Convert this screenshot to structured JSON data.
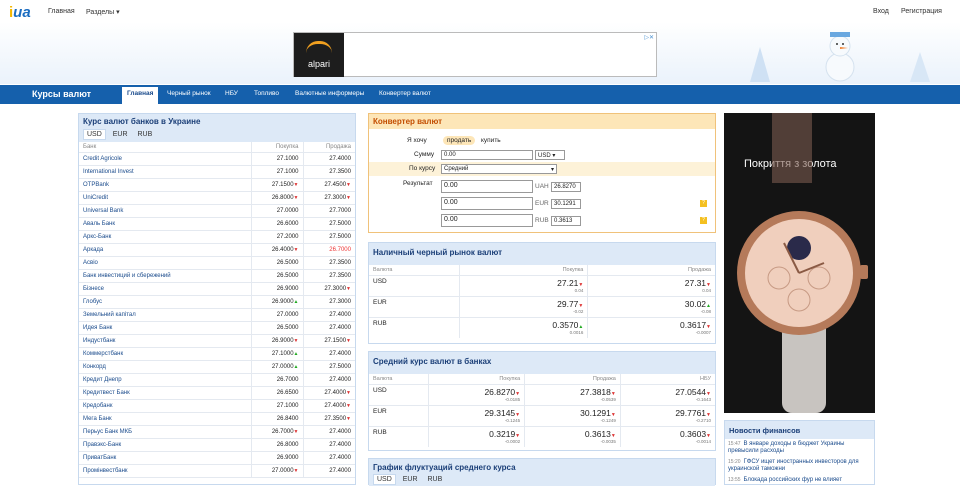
{
  "top": {
    "logo_main": "i",
    "logo_ua": "ua",
    "home": "Главная",
    "sections": "Разделы",
    "login": "Вход",
    "register": "Регистрация"
  },
  "ad": {
    "brand": "alpari"
  },
  "nav": {
    "title": "Курсы валют",
    "items": [
      "Главная",
      "Черный рынок",
      "НБУ",
      "Топливо",
      "Валютные информеры",
      "Конвертер валют"
    ]
  },
  "banks": {
    "title": "Курс валют банков в Украине",
    "tabs": [
      "USD",
      "EUR",
      "RUB"
    ],
    "col_bank": "Банк",
    "col_buy": "Покупка",
    "col_sell": "Продажа",
    "rows": [
      [
        "Credit Agricole",
        "27.1000",
        "",
        "27.4000",
        ""
      ],
      [
        "International Invest",
        "27.1000",
        "",
        "27.3500",
        ""
      ],
      [
        "OTPBank",
        "27.1500",
        "dn",
        "27.4500",
        "dn"
      ],
      [
        "UniCredit",
        "26.8000",
        "dn",
        "27.3000",
        "dn"
      ],
      [
        "Universal Bank",
        "27.0000",
        "",
        "27.7000",
        ""
      ],
      [
        "Аваль Банк",
        "26.6000",
        "",
        "27.5000",
        ""
      ],
      [
        "Аркс-Банк",
        "27.2000",
        "",
        "27.5000",
        ""
      ],
      [
        "Аркада",
        "26.4000",
        "dn",
        "26.7000",
        "red"
      ],
      [
        "Асвіо",
        "26.5000",
        "",
        "27.3500",
        ""
      ],
      [
        "Банк инвестиций и сбережений",
        "26.5000",
        "",
        "27.3500",
        ""
      ],
      [
        "Бізнесе",
        "26.9000",
        "",
        "27.3000",
        "dn"
      ],
      [
        "Глобус",
        "26.9000",
        "up",
        "27.3000",
        ""
      ],
      [
        "Земельний капітал",
        "27.0000",
        "",
        "27.4000",
        ""
      ],
      [
        "Идея Банк",
        "26.5000",
        "",
        "27.4000",
        ""
      ],
      [
        "Индустбанк",
        "26.9000",
        "dn",
        "27.1500",
        "dn"
      ],
      [
        "Коммерстбанк",
        "27.1000",
        "up",
        "27.4000",
        ""
      ],
      [
        "Конкорд",
        "27.0000",
        "up",
        "27.5000",
        ""
      ],
      [
        "Кредит Днепр",
        "26.7000",
        "",
        "27.4000",
        ""
      ],
      [
        "Кредитвест Банк",
        "26.6500",
        "",
        "27.4000",
        "dn"
      ],
      [
        "Кредобанк",
        "27.1000",
        "",
        "27.4000",
        "dn"
      ],
      [
        "Мега Банк",
        "26.8400",
        "",
        "27.3500",
        "dn"
      ],
      [
        "Перьуc Банк МКБ",
        "26.7000",
        "dn",
        "27.4000",
        ""
      ],
      [
        "Правэкс-Банк",
        "26.8000",
        "",
        "27.4000",
        ""
      ],
      [
        "ПриватБанк",
        "26.9000",
        "",
        "27.4000",
        ""
      ],
      [
        "Промінвестбанк",
        "27.0000",
        "dn",
        "27.4000",
        ""
      ]
    ]
  },
  "converter": {
    "title": "Конвертер валют",
    "want_label": "Я хочу",
    "sell": "продать",
    "buy": "купить",
    "sum_label": "Сумму",
    "sum_value": "0.00",
    "currency": "USD",
    "rate_label": "По курсу",
    "rate_value": "Средний",
    "result_label": "Результат",
    "results": [
      {
        "value": "0.00",
        "cur": "UAH",
        "rate": "26.8270"
      },
      {
        "value": "0.00",
        "cur": "EUR",
        "rate": "30.1291"
      },
      {
        "value": "0.00",
        "cur": "RUB",
        "rate": "0.3613"
      }
    ]
  },
  "black": {
    "title": "Наличный черный рынок валют",
    "col_cur": "Валюта",
    "col_buy": "Покупка",
    "col_sell": "Продажа",
    "rows": [
      {
        "cur": "USD",
        "buy": "27.21",
        "buy_d": "0.04",
        "buy_dir": "dn",
        "sell": "27.31",
        "sell_d": "0.04",
        "sell_dir": "dn"
      },
      {
        "cur": "EUR",
        "buy": "29.77",
        "buy_d": "-0.02",
        "buy_dir": "dn",
        "sell": "30.02",
        "sell_d": "-0.08",
        "sell_dir": "up"
      },
      {
        "cur": "RUB",
        "buy": "0.3570",
        "buy_d": "0.0016",
        "buy_dir": "up",
        "sell": "0.3617",
        "sell_d": "-0.0007",
        "sell_dir": "dn"
      }
    ]
  },
  "avg": {
    "title": "Средний курс валют в банках",
    "col_cur": "Валюта",
    "col_buy": "Покупка",
    "col_sell": "Продажа",
    "col_nbu": "НБУ",
    "rows": [
      {
        "cur": "USD",
        "buy": "26.8270",
        "buy_d": "-0.0185",
        "sell": "27.3818",
        "sell_d": "-0.0539",
        "nbu": "27.0544",
        "nbu_d": "-0.1643"
      },
      {
        "cur": "EUR",
        "buy": "29.3145",
        "buy_d": "-0.1245",
        "sell": "30.1291",
        "sell_d": "-0.1249",
        "nbu": "29.7761",
        "nbu_d": "-0.2710"
      },
      {
        "cur": "RUB",
        "buy": "0.3219",
        "buy_d": "-0.0002",
        "sell": "0.3613",
        "sell_d": "-0.0035",
        "nbu": "0.3603",
        "nbu_d": "-0.0014"
      }
    ]
  },
  "chart": {
    "title": "График флуктуаций среднего курса",
    "tabs": [
      "USD",
      "EUR",
      "RUB"
    ]
  },
  "watch": {
    "text": "Покриття з золота"
  },
  "news": {
    "title": "Новости финансов",
    "items": [
      {
        "time": "15:47",
        "text": "В январе доходы в бюджет Украины превысили расходы"
      },
      {
        "time": "15:20",
        "text": "ГФСУ ищет иностранных инвесторов для украинской таможни"
      },
      {
        "time": "13:55",
        "text": "Блокада российских фур не влияет"
      }
    ]
  }
}
